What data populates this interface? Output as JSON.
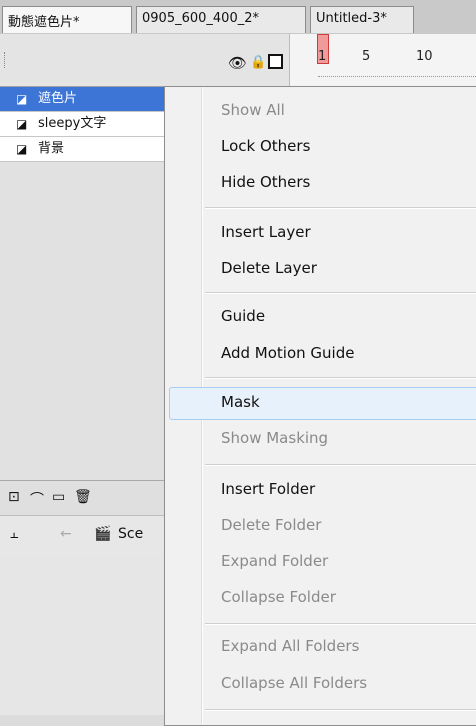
{
  "tabs": [
    "動態遮色片*",
    "0905_600_400_2*",
    "Untitled-3*"
  ],
  "timeline": {
    "ruler_labels": [
      "1",
      "5",
      "10"
    ]
  },
  "layers": [
    {
      "name": "遮色片",
      "selected": true
    },
    {
      "name": "sleepy文字",
      "selected": false
    },
    {
      "name": "背景",
      "selected": false
    }
  ],
  "edit_bar": {
    "scene_label": "Sce"
  },
  "context_menu": {
    "items": [
      {
        "label": "Show All",
        "enabled": false
      },
      {
        "label": "Lock Others",
        "enabled": true
      },
      {
        "label": "Hide Others",
        "enabled": true
      },
      {
        "label": "Insert Layer",
        "enabled": true
      },
      {
        "label": "Delete Layer",
        "enabled": true
      },
      {
        "label": "Guide",
        "enabled": true
      },
      {
        "label": "Add Motion Guide",
        "enabled": true
      },
      {
        "label": "Mask",
        "enabled": true,
        "highlighted": true
      },
      {
        "label": "Show Masking",
        "enabled": false
      },
      {
        "label": "Insert Folder",
        "enabled": true
      },
      {
        "label": "Delete Folder",
        "enabled": false
      },
      {
        "label": "Expand Folder",
        "enabled": false
      },
      {
        "label": "Collapse Folder",
        "enabled": false
      },
      {
        "label": "Expand All Folders",
        "enabled": false
      },
      {
        "label": "Collapse All Folders",
        "enabled": false
      }
    ]
  }
}
